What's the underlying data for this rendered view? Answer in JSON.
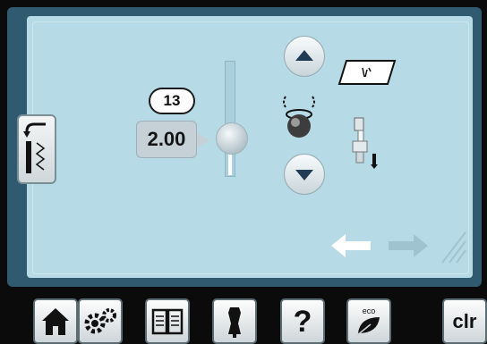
{
  "tension": {
    "step_label": "13",
    "value": "2.00",
    "level": 0.45
  },
  "toolbar": {
    "clr_label": "clr",
    "help_label": "?",
    "eco_label": "eco"
  },
  "colors": {
    "frame": "#2f5a70",
    "panel": "#b6dbe6",
    "arrow_dark": "#223b55"
  }
}
